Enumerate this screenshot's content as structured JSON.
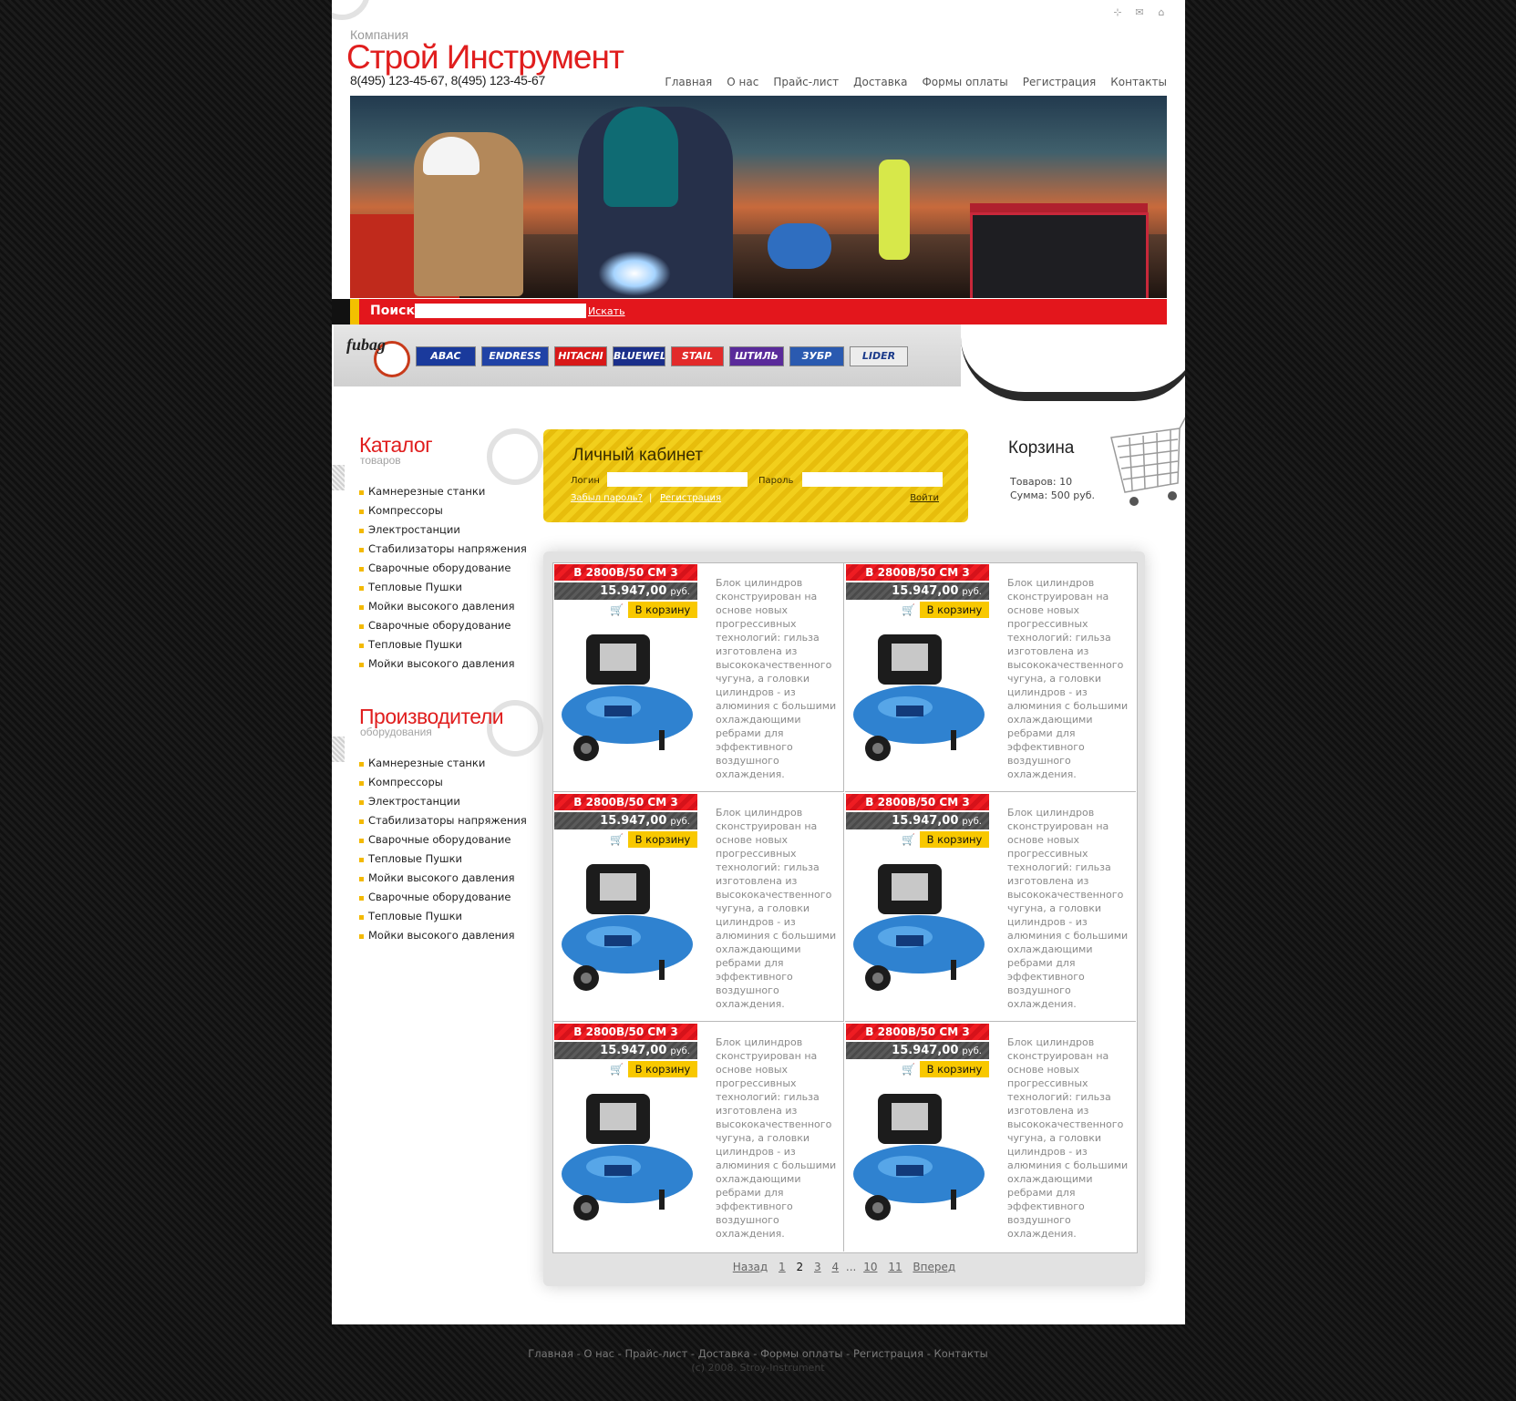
{
  "header": {
    "company_label": "Компания",
    "brand": "Строй Инструмент",
    "phones": "8(495) 123-45-67, 8(495) 123-45-67",
    "icons": [
      "sitemap-icon",
      "mail-icon",
      "home-icon"
    ]
  },
  "nav": [
    "Главная",
    "О нас",
    "Прайс-лист",
    "Доставка",
    "Формы оплаты",
    "Регистрация",
    "Контакты"
  ],
  "search": {
    "label": "Поиск",
    "value": "",
    "button": "Искать"
  },
  "brands": [
    "fubag",
    "ABAC",
    "ENDRESS",
    "HITACHI",
    "BLUEWELD",
    "STAIL",
    "ШТИЛЬ",
    "ЗУБР",
    "LIDER"
  ],
  "catalog": {
    "title": "Каталог",
    "subtitle": "товаров",
    "items": [
      "Камнерезные станки",
      "Компрессоры",
      "Электростанции",
      "Стабилизаторы напряжения",
      "Сварочные оборудование",
      "Тепловые Пушки",
      "Мойки высокого давления",
      "Сварочные оборудование",
      "Тепловые Пушки",
      "Мойки высокого давления"
    ]
  },
  "makers": {
    "title": "Производители",
    "subtitle": "оборудования",
    "items": [
      "Камнерезные станки",
      "Компрессоры",
      "Электростанции",
      "Стабилизаторы напряжения",
      "Сварочные оборудование",
      "Тепловые Пушки",
      "Мойки высокого давления",
      "Сварочные оборудование",
      "Тепловые Пушки",
      "Мойки высокого давления"
    ]
  },
  "login": {
    "title": "Личный кабинет",
    "login_label": "Логин",
    "password_label": "Пароль",
    "forgot": "Забыл пароль?",
    "separator": "|",
    "register": "Регистрация",
    "submit": "Войти"
  },
  "cart": {
    "title": "Корзина",
    "items_label": "Товаров:",
    "items_value": "10",
    "sum_label": "Сумма:",
    "sum_value": "500 руб."
  },
  "products": [
    {
      "name": "В 2800В/50 СМ 3",
      "price": "15.947,00",
      "currency": "руб.",
      "buy": "В корзину",
      "desc": "Блок цилиндров сконструирован на основе новых прогрессивных технологий: гильза изготовлена из высококачественного чугуна, а головки цилиндров - из алюминия с большими охлаждающими ребрами для эффективного воздушного охлаждения."
    },
    {
      "name": "В 2800В/50 СМ 3",
      "price": "15.947,00",
      "currency": "руб.",
      "buy": "В корзину",
      "desc": "Блок цилиндров сконструирован на основе новых прогрессивных технологий: гильза изготовлена из высококачественного чугуна, а головки цилиндров - из алюминия с большими охлаждающими ребрами для эффективного воздушного охлаждения."
    },
    {
      "name": "В 2800В/50 СМ 3",
      "price": "15.947,00",
      "currency": "руб.",
      "buy": "В корзину",
      "desc": "Блок цилиндров сконструирован на основе новых прогрессивных технологий: гильза изготовлена из высококачественного чугуна, а головки цилиндров - из алюминия с большими охлаждающими ребрами для эффективного воздушного охлаждения."
    },
    {
      "name": "В 2800В/50 СМ 3",
      "price": "15.947,00",
      "currency": "руб.",
      "buy": "В корзину",
      "desc": "Блок цилиндров сконструирован на основе новых прогрессивных технологий: гильза изготовлена из высококачественного чугуна, а головки цилиндров - из алюминия с большими охлаждающими ребрами для эффективного воздушного охлаждения."
    },
    {
      "name": "В 2800В/50 СМ 3",
      "price": "15.947,00",
      "currency": "руб.",
      "buy": "В корзину",
      "desc": "Блок цилиндров сконструирован на основе новых прогрессивных технологий: гильза изготовлена из высококачественного чугуна, а головки цилиндров - из алюминия с большими охлаждающими ребрами для эффективного воздушного охлаждения."
    },
    {
      "name": "В 2800В/50 СМ 3",
      "price": "15.947,00",
      "currency": "руб.",
      "buy": "В корзину",
      "desc": "Блок цилиндров сконструирован на основе новых прогрессивных технологий: гильза изготовлена из высококачественного чугуна, а головки цилиндров - из алюминия с большими охлаждающими ребрами для эффективного воздушного охлаждения."
    }
  ],
  "pager": {
    "prev": "Назад",
    "pages": [
      "1",
      "2",
      "3",
      "4",
      "...",
      "10",
      "11"
    ],
    "current": "2",
    "next": "Вперед"
  },
  "footer": {
    "links": [
      "Главная",
      "О нас",
      "Прайс-лист",
      "Доставка",
      "Формы оплаты",
      "Регистрация",
      "Контакты"
    ],
    "separator": " - ",
    "copyright": "(c) 2008. Stroy-Instrument"
  },
  "colors": {
    "accent_red": "#e01e1e",
    "accent_yellow": "#f3c000",
    "background": "#141414"
  }
}
